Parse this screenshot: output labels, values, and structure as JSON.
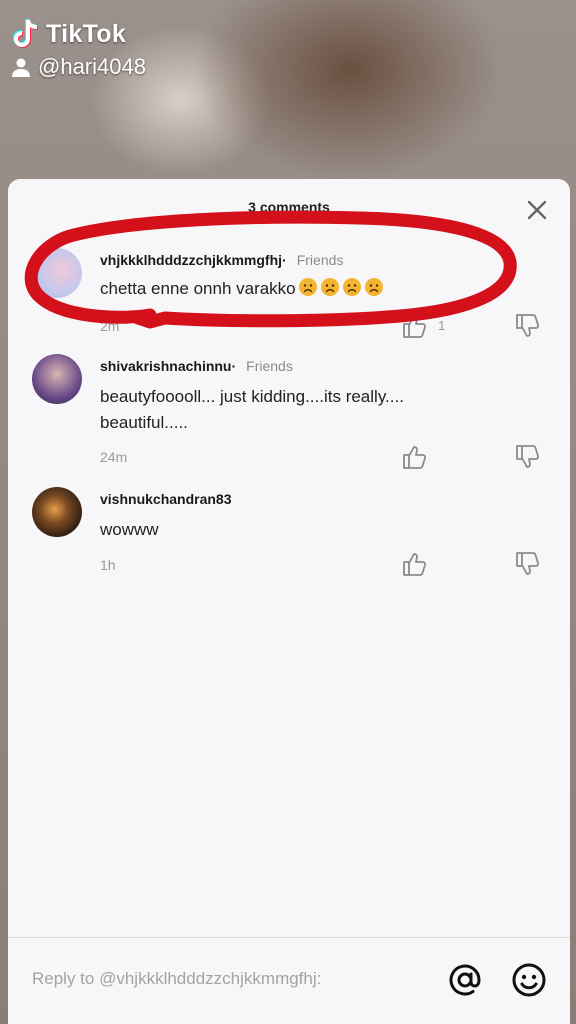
{
  "watermark": {
    "brand": "TikTok",
    "handle": "@hari4048"
  },
  "comments_panel": {
    "title": "3 comments",
    "close_icon": "close-icon",
    "comments": [
      {
        "username": "vhjkkklhdddzzchjkkmmgfhj·",
        "badge": "Friends",
        "text": "chetta enne onnh varakko",
        "emojis": [
          "sad-face",
          "sad-face",
          "sad-face",
          "sad-face"
        ],
        "time": "2m",
        "likes": "1"
      },
      {
        "username": "shivakrishnachinnu·",
        "badge": "Friends",
        "text": "beautyfooooll... just kidding....its really.... beautiful.....",
        "time": "24m"
      },
      {
        "username": "vishnukchandran83",
        "badge": "",
        "text": "wowww",
        "time": "1h"
      }
    ]
  },
  "reply": {
    "placeholder": "Reply to @vhjkkklhdddzzchjkkmmgfhj:"
  },
  "colors": {
    "annotation": "#d4101a",
    "sheet": "#f7f7f9",
    "tiktok_cyan": "#25f4ee",
    "tiktok_red": "#fe2c55"
  }
}
